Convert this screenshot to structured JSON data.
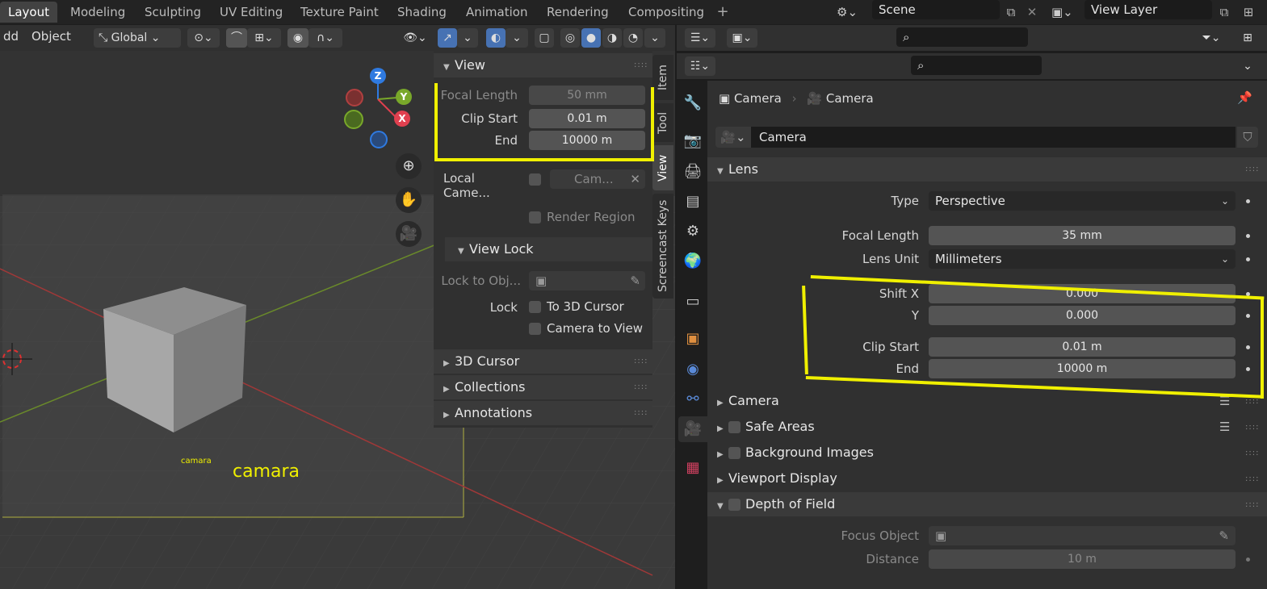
{
  "workspaces": {
    "tabs": [
      "Layout",
      "Modeling",
      "Sculpting",
      "UV Editing",
      "Texture Paint",
      "Shading",
      "Animation",
      "Rendering",
      "Compositing"
    ]
  },
  "scene": {
    "name": "Scene",
    "view_layer": "View Layer"
  },
  "viewport_header": {
    "add": "dd",
    "object": "Object",
    "transform": "Global"
  },
  "npanel": {
    "tabs": [
      "Item",
      "Tool",
      "View",
      "Screencast Keys"
    ],
    "view": {
      "title": "View",
      "focal_length_label": "Focal Length",
      "focal_length": "50 mm",
      "clip_start_label": "Clip Start",
      "clip_start": "0.01 m",
      "end_label": "End",
      "end": "10000 m",
      "local_camera_label": "Local Came...",
      "local_camera_value": "Cam...",
      "render_region": "Render Region"
    },
    "view_lock": {
      "title": "View Lock",
      "lock_to_obj_label": "Lock to Obj...",
      "lock_label": "Lock",
      "to_3d_cursor": "To 3D Cursor",
      "camera_to_view": "Camera to View"
    },
    "collapsed": [
      "3D Cursor",
      "Collections",
      "Annotations"
    ]
  },
  "viewport": {
    "camera_label_small": "camara",
    "camera_label_large": "camara"
  },
  "properties": {
    "breadcrumb": {
      "object": "Camera",
      "data": "Camera"
    },
    "datablock_name": "Camera",
    "lens": {
      "title": "Lens",
      "type_label": "Type",
      "type": "Perspective",
      "focal_label": "Focal Length",
      "focal": "35 mm",
      "unit_label": "Lens Unit",
      "unit": "Millimeters",
      "shift_x_label": "Shift X",
      "shift_x": "0.000",
      "y_label": "Y",
      "y": "0.000",
      "clip_start_label": "Clip Start",
      "clip_start": "0.01 m",
      "end_label": "End",
      "end": "10000 m"
    },
    "sections": [
      "Camera",
      "Safe Areas",
      "Background Images",
      "Viewport Display",
      "Depth of Field"
    ],
    "dof": {
      "focus_object_label": "Focus Object",
      "distance_label": "Distance",
      "distance": "10 m"
    }
  },
  "colors": {
    "highlight": "#f0f000",
    "accent": "#4772b3"
  }
}
